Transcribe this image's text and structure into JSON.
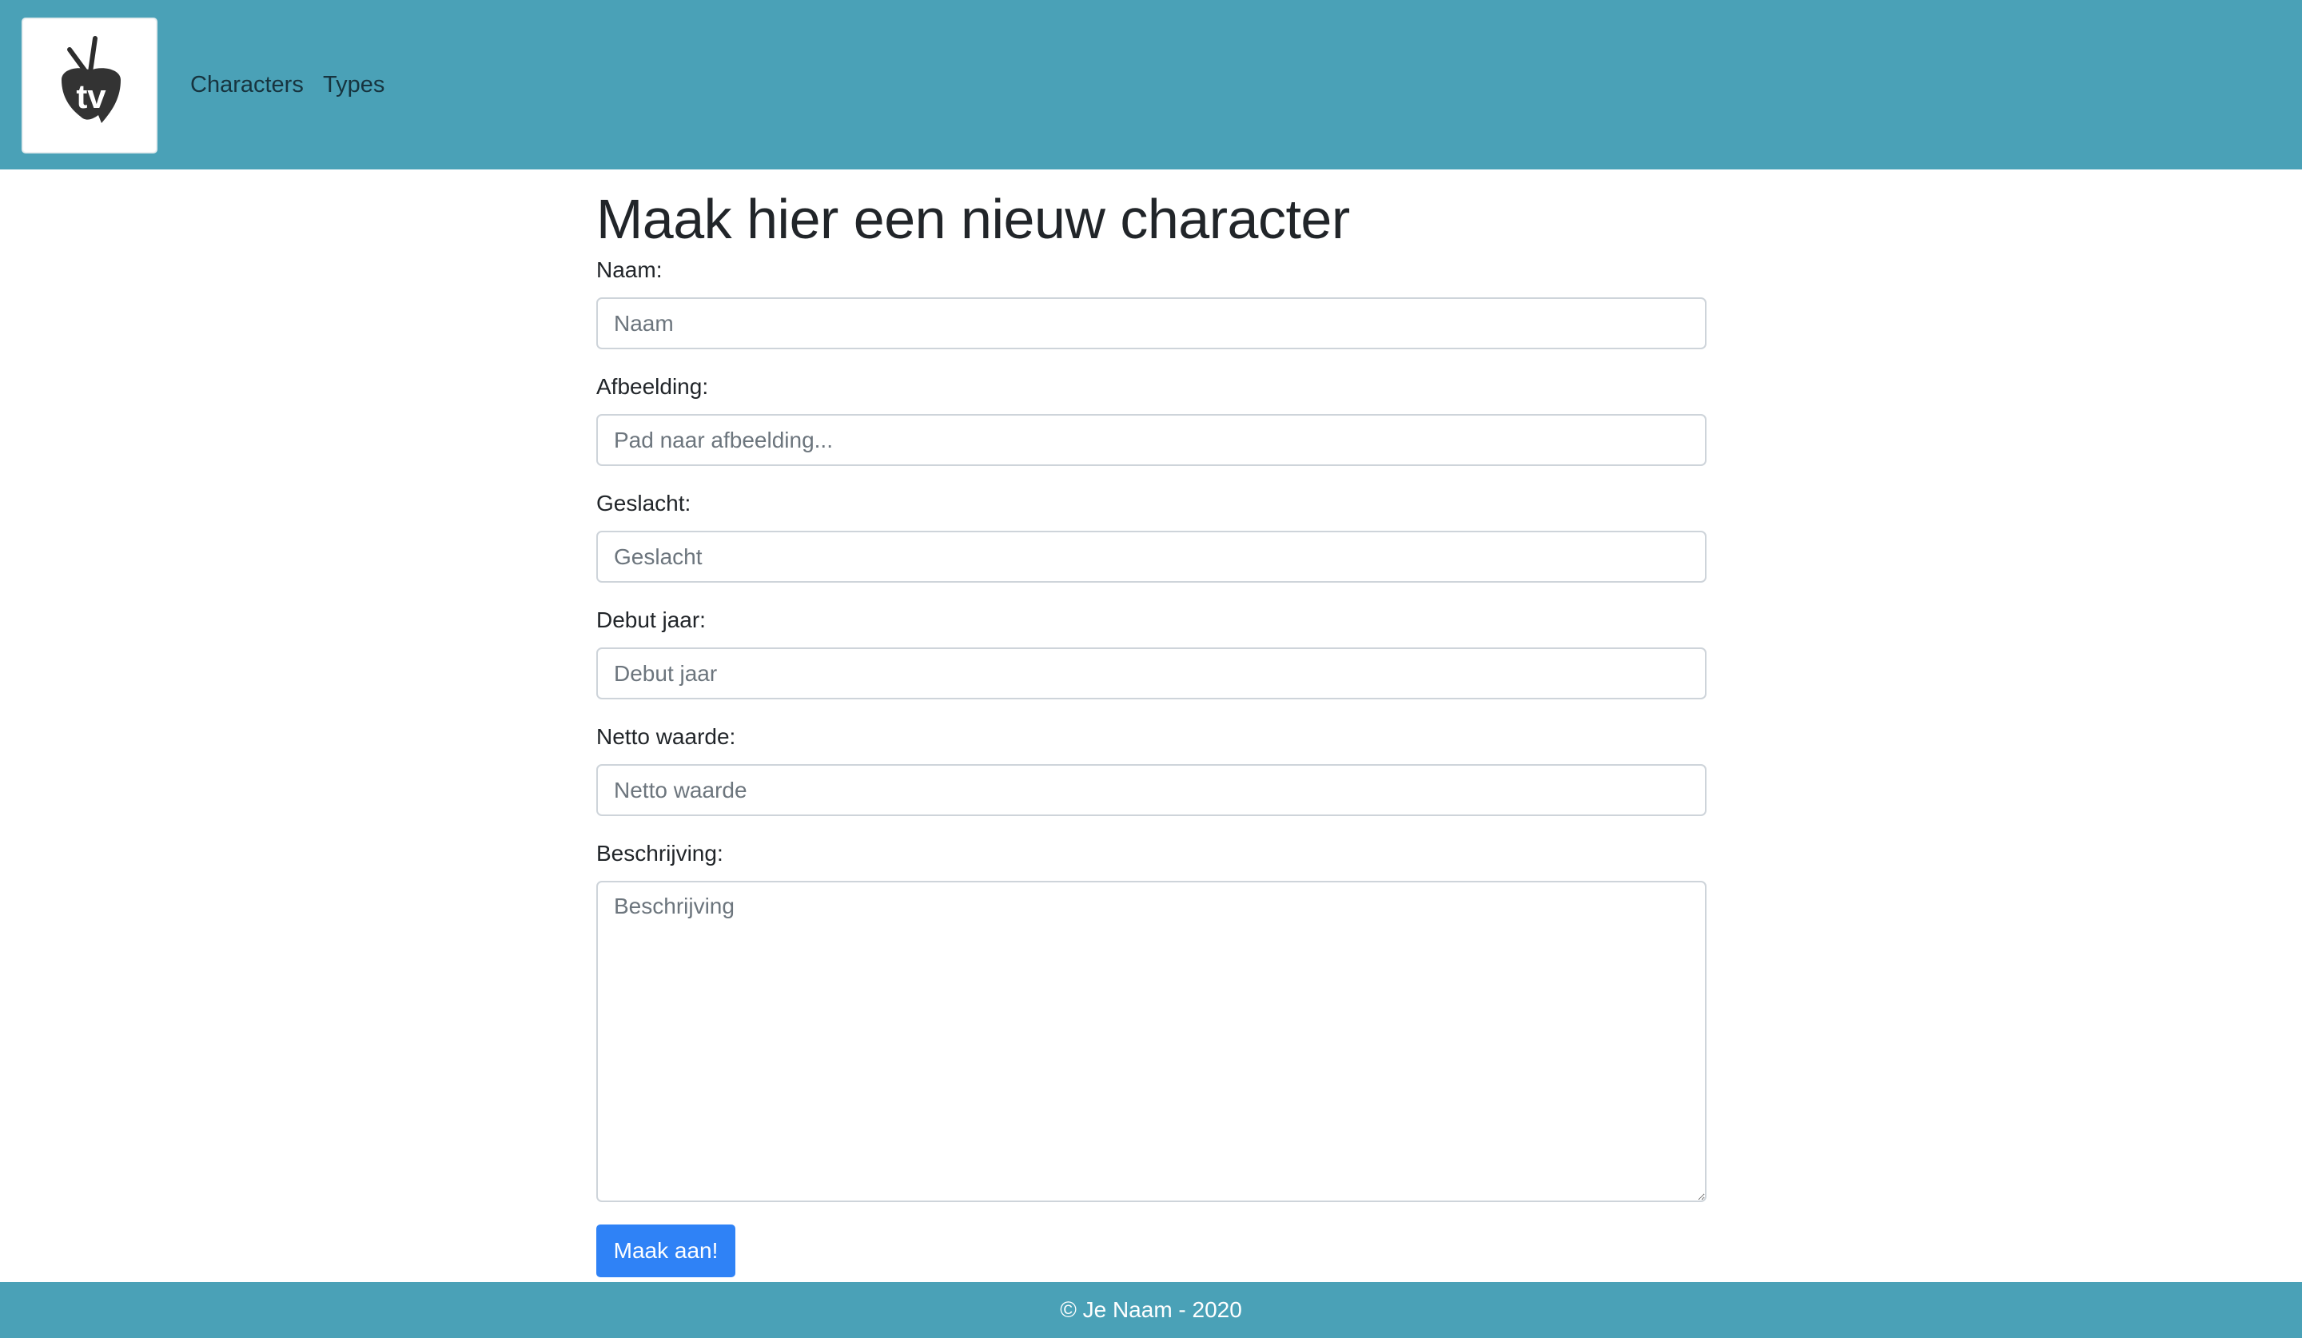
{
  "navbar": {
    "logo_icon": "tv-logo-icon",
    "logo_text": "tv",
    "links": [
      {
        "label": "Characters"
      },
      {
        "label": "Types"
      }
    ],
    "background_color": "#4aa1b7"
  },
  "form": {
    "title": "Maak hier een nieuw character",
    "fields": [
      {
        "label": "Naam:",
        "placeholder": "Naam",
        "value": ""
      },
      {
        "label": "Afbeelding:",
        "placeholder": "Pad naar afbeelding...",
        "value": ""
      },
      {
        "label": "Geslacht:",
        "placeholder": "Geslacht",
        "value": ""
      },
      {
        "label": "Debut jaar:",
        "placeholder": "Debut jaar",
        "value": ""
      },
      {
        "label": "Netto waarde:",
        "placeholder": "Netto waarde",
        "value": ""
      },
      {
        "label": "Beschrijving:",
        "placeholder": "Beschrijving",
        "value": ""
      }
    ],
    "submit_label": "Maak aan!",
    "submit_color": "#2f82f6"
  },
  "footer": {
    "text": "© Je Naam - 2020"
  }
}
